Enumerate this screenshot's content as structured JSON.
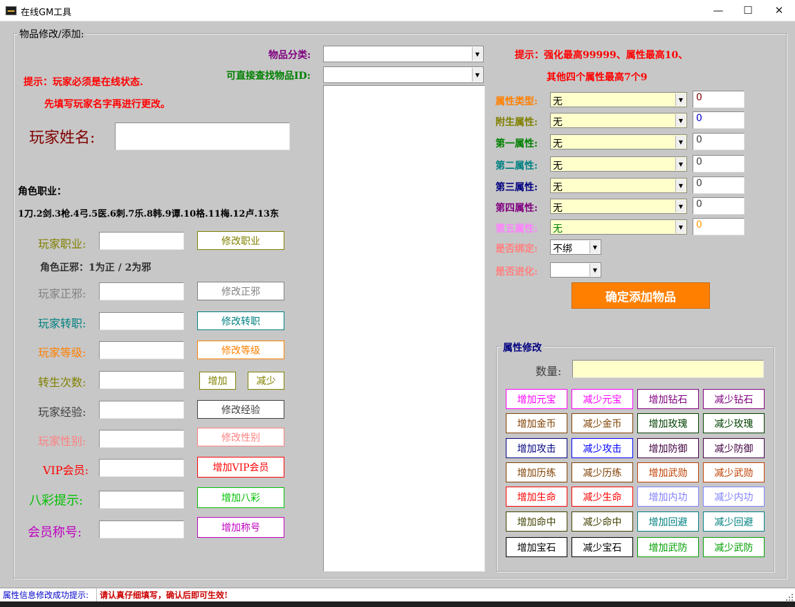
{
  "window": {
    "title": "在线GM工具",
    "minimize": "—",
    "maximize": "☐",
    "close": "✕"
  },
  "left_group": {
    "legend": "物品修改/添加:",
    "tip_line1": "提示：玩家必须是在线状态.",
    "tip_line2": "先填写玩家名字再进行更改。",
    "player_name_label": "玩家姓名:",
    "player_name_value": "",
    "role_job_label": "角色职业：",
    "role_job_list": "1刀.2剑.3枪.4弓.5医.6刺.7乐.8韩.9谭.10格.11梅.12卢.13东",
    "alignment_hint": "角色正邪：1为正 / 2为邪",
    "rows": [
      {
        "label": "玩家职业:",
        "color": "#808000",
        "value": "",
        "button": "修改职业",
        "button_color": "#808000"
      },
      {
        "label": "玩家正邪:",
        "color": "#808080",
        "value": "",
        "button": "修改正邪",
        "button_color": "#808080"
      },
      {
        "label": "玩家转职:",
        "color": "#008080",
        "value": "",
        "button": "修改转职",
        "button_color": "#008080"
      },
      {
        "label": "玩家等级:",
        "color": "#ff8000",
        "value": "",
        "button": "修改等级",
        "button_color": "#ff8000"
      },
      {
        "label": "转生次数:",
        "color": "#808000",
        "value": "",
        "button_add": "增加",
        "button_sub": "减少",
        "button_color": "#808000"
      },
      {
        "label": "玩家经验:",
        "color": "#404040",
        "value": "",
        "button": "修改经验",
        "button_color": "#404040"
      },
      {
        "label": "玩家性别:",
        "color": "#ff8080",
        "value": "",
        "button": "修改性别",
        "button_color": "#ff8080"
      },
      {
        "label": "VIP会员:",
        "color": "#ff0000",
        "value": "",
        "button": "增加VIP会员",
        "button_color": "#ff0000"
      },
      {
        "label": "八彩提示:",
        "color": "#00c000",
        "value": "",
        "button": "增加八彩",
        "button_color": "#00c000"
      },
      {
        "label": "会员称号:",
        "color": "#c000c0",
        "value": "",
        "button": "增加称号",
        "button_color": "#c000c0"
      }
    ]
  },
  "item": {
    "category_label": "物品分类:",
    "category_value": "",
    "find_id_label": "可直接查找物品ID:",
    "find_id_value": ""
  },
  "attr": {
    "tip_line1": "提示：强化最高99999、属性最高10、",
    "tip_line2": "其他四个属性最高7个9",
    "rows": [
      {
        "label": "属性类型:",
        "color": "#ff8000",
        "combo": "无",
        "combo_color": "#000000",
        "num": "0",
        "num_color": "#800000"
      },
      {
        "label": "附生属性:",
        "color": "#808000",
        "combo": "无",
        "combo_color": "#000000",
        "num": "0",
        "num_color": "#0000cc"
      },
      {
        "label": "第一属性:",
        "color": "#008000",
        "combo": "无",
        "combo_color": "#000000",
        "num": "0",
        "num_color": "#404040"
      },
      {
        "label": "第二属性:",
        "color": "#008080",
        "combo": "无",
        "combo_color": "#000000",
        "num": "0",
        "num_color": "#404040"
      },
      {
        "label": "第三属性:",
        "color": "#000080",
        "combo": "无",
        "combo_color": "#000000",
        "num": "0",
        "num_color": "#404040"
      },
      {
        "label": "第四属性:",
        "color": "#800080",
        "combo": "无",
        "combo_color": "#000000",
        "num": "0",
        "num_color": "#404040"
      },
      {
        "label": "第五属性:",
        "color": "#ff80ff",
        "combo": "无",
        "combo_color": "#008000",
        "num": "0",
        "num_color": "#ff9900"
      }
    ],
    "bind_label": "是否绑定:",
    "bind_value": "不绑",
    "evolve_label": "是否进化:",
    "evolve_value": "",
    "confirm_button": "确定添加物品"
  },
  "modify_group": {
    "legend": "属性修改",
    "qty_label": "数量:",
    "qty_value": "",
    "buttons": [
      [
        {
          "t": "增加元宝",
          "c": "#ff00ff"
        },
        {
          "t": "减少元宝",
          "c": "#ff00ff"
        },
        {
          "t": "增加钻石",
          "c": "#800080"
        },
        {
          "t": "减少钻石",
          "c": "#800080"
        }
      ],
      [
        {
          "t": "增加金币",
          "c": "#804000"
        },
        {
          "t": "减少金币",
          "c": "#804000"
        },
        {
          "t": "增加玫瑰",
          "c": "#004000"
        },
        {
          "t": "减少玫瑰",
          "c": "#004000"
        }
      ],
      [
        {
          "t": "增加攻击",
          "c": "#000080"
        },
        {
          "t": "减少攻击",
          "c": "#0000ff"
        },
        {
          "t": "增加防御",
          "c": "#400040"
        },
        {
          "t": "减少防御",
          "c": "#400040"
        }
      ],
      [
        {
          "t": "增加历练",
          "c": "#804000"
        },
        {
          "t": "减少历练",
          "c": "#804000"
        },
        {
          "t": "增加武勋",
          "c": "#c04000"
        },
        {
          "t": "减少武勋",
          "c": "#c04000"
        }
      ],
      [
        {
          "t": "增加生命",
          "c": "#ff0000"
        },
        {
          "t": "减少生命",
          "c": "#ff0000"
        },
        {
          "t": "增加内功",
          "c": "#8080ff"
        },
        {
          "t": "减少内功",
          "c": "#8080ff"
        }
      ],
      [
        {
          "t": "增加命中",
          "c": "#404000"
        },
        {
          "t": "减少命中",
          "c": "#404000"
        },
        {
          "t": "增加回避",
          "c": "#008080"
        },
        {
          "t": "减少回避",
          "c": "#008080"
        }
      ],
      [
        {
          "t": "增加宝石",
          "c": "#000000"
        },
        {
          "t": "减少宝石",
          "c": "#000000"
        },
        {
          "t": "增加武防",
          "c": "#00a000"
        },
        {
          "t": "减少武防",
          "c": "#00a000"
        }
      ]
    ]
  },
  "status": {
    "left": "属性信息修改成功提示:",
    "right": "请认真仔细填写，确认后即可生效!"
  }
}
